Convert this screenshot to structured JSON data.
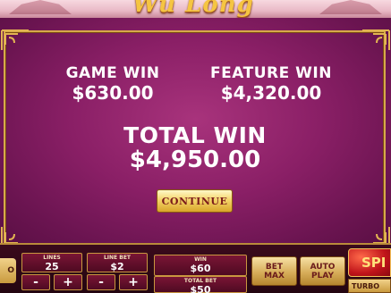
{
  "logo": {
    "text": "Wu Long"
  },
  "result": {
    "game_win_label": "GAME WIN",
    "game_win_value": "$630.00",
    "feature_win_label": "FEATURE WIN",
    "feature_win_value": "$4,320.00",
    "total_win_label": "TOTAL WIN",
    "total_win_value": "$4,950.00",
    "continue_label": "CONTINUE"
  },
  "controls": {
    "left_button_label": "O",
    "lines_label": "LINES",
    "lines_value": "25",
    "line_bet_label": "LINE BET",
    "line_bet_value": "$2",
    "minus": "-",
    "plus": "+",
    "win_label": "WIN",
    "win_value": "$60",
    "total_bet_label": "TOTAL BET",
    "total_bet_value": "$50",
    "bet_max_label": "BET\nMAX",
    "auto_play_label": "AUTO\nPLAY",
    "spin_label": "SPI",
    "turbo_label": "TURBO"
  },
  "colors": {
    "panel": "#8a1f66",
    "gold": "#d7a94a",
    "text": "#ffffff"
  }
}
